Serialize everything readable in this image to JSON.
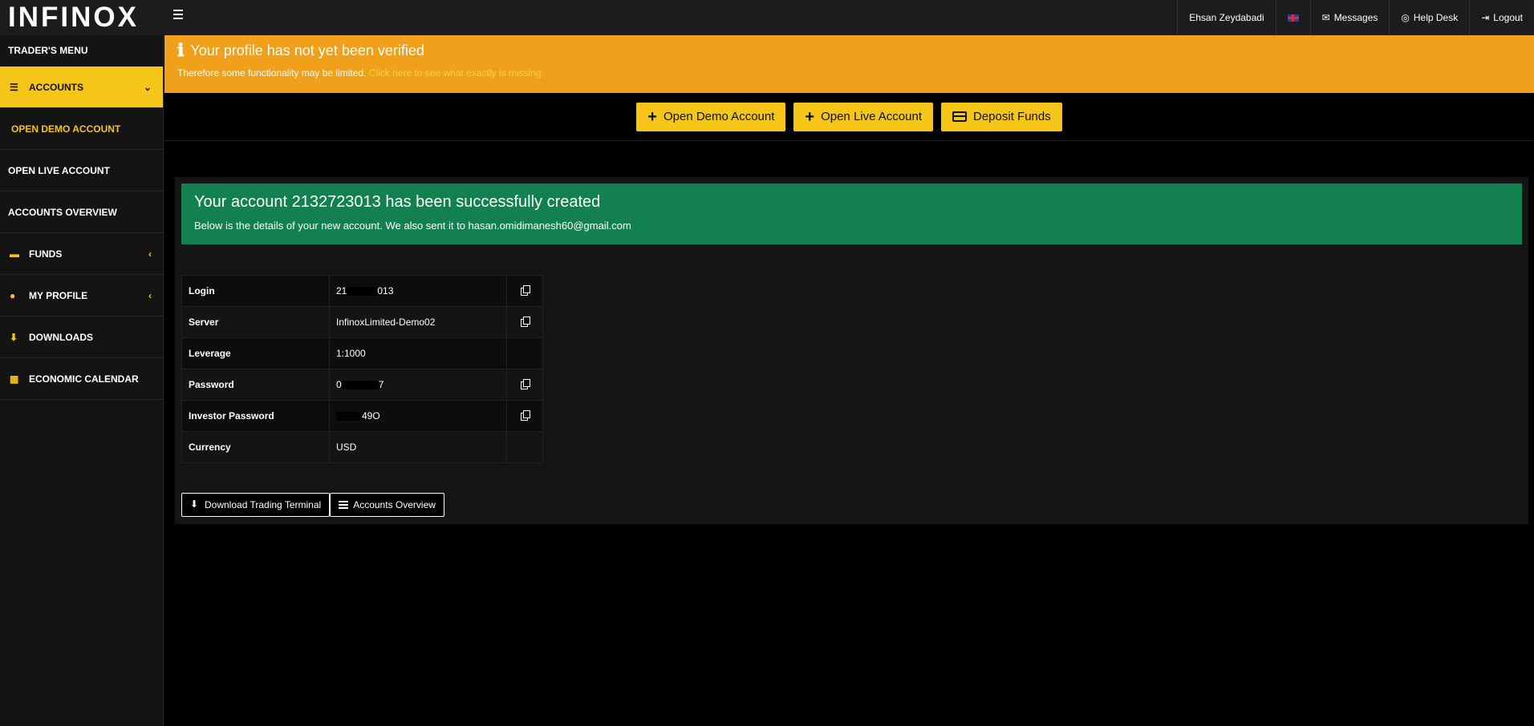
{
  "app": {
    "logo": "INFINOX"
  },
  "topnav": {
    "user": "Ehsan Zeydabadi",
    "messages": "Messages",
    "helpdesk": "Help Desk",
    "logout": "Logout"
  },
  "sidebar": {
    "title": "TRADER'S MENU",
    "accounts": "ACCOUNTS",
    "open_demo": "OPEN DEMO ACCOUNT",
    "open_live": "OPEN LIVE ACCOUNT",
    "overview": "ACCOUNTS OVERVIEW",
    "funds": "FUNDS",
    "profile": "MY PROFILE",
    "downloads": "DOWNLOADS",
    "calendar": "ECONOMIC CALENDAR"
  },
  "alert": {
    "title": "Your profile has not yet been verified",
    "text": "Therefore some functionality may be limited.",
    "link": "Click here to see what exactly is missing"
  },
  "actions": {
    "demo": "Open Demo Account",
    "live": "Open Live Account",
    "deposit": "Deposit Funds"
  },
  "success": {
    "title": "Your account 2132723013 has been successfully created",
    "text": "Below is the details of your new account. We also sent it to hasan.omidimanesh60@gmail.com"
  },
  "details": {
    "login_label": "Login",
    "login_pre": "21",
    "login_post": "013",
    "server_label": "Server",
    "server": "InfinoxLimited-Demo02",
    "leverage_label": "Leverage",
    "leverage": "1:1000",
    "password_label": "Password",
    "password_pre": "0",
    "password_post": "7",
    "investor_label": "Investor Password",
    "investor_post": "49O",
    "currency_label": "Currency",
    "currency": "USD"
  },
  "bottom": {
    "download": "Download Trading Terminal",
    "overview": "Accounts Overview"
  },
  "colors": {
    "accent": "#f5c518",
    "alert": "#f0a01a",
    "success": "#138050"
  }
}
